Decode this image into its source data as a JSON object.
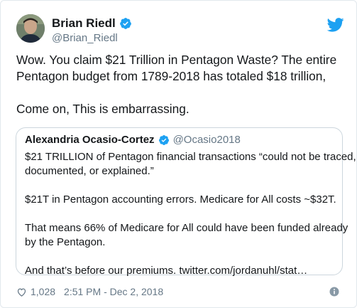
{
  "tweet": {
    "author": {
      "name": "Brian Riedl",
      "handle": "@Brian_Riedl",
      "verified_icon": "verified-badge-icon"
    },
    "lines": [
      "Wow.   You claim $21 Trillion in Pentagon Waste?    The entire",
      "Pentagon budget from 1789-2018 has totaled $18 trillion,",
      "",
      "Come on,  This is embarrassing."
    ],
    "quoted": {
      "name": "Alexandria Ocasio-Cortez",
      "handle": "@Ocasio2018",
      "lines": [
        "$21 TRILLION of Pentagon financial transactions “could not be traced,",
        "documented, or explained.”",
        "",
        "$21T in Pentagon accounting errors. Medicare for All costs ~$32T.",
        "",
        "That means 66% of Medicare for All could have been funded already",
        "by the Pentagon.",
        "",
        "And that’s before our premiums. twitter.com/jordanuhl/stat…"
      ]
    },
    "footer": {
      "likes": "1,028",
      "timestamp": "2:51 PM - Dec 2, 2018"
    }
  },
  "colors": {
    "brand_blue": "#1da1f2",
    "text": "#14171a",
    "muted": "#657786",
    "border": "#ccd6dd"
  }
}
